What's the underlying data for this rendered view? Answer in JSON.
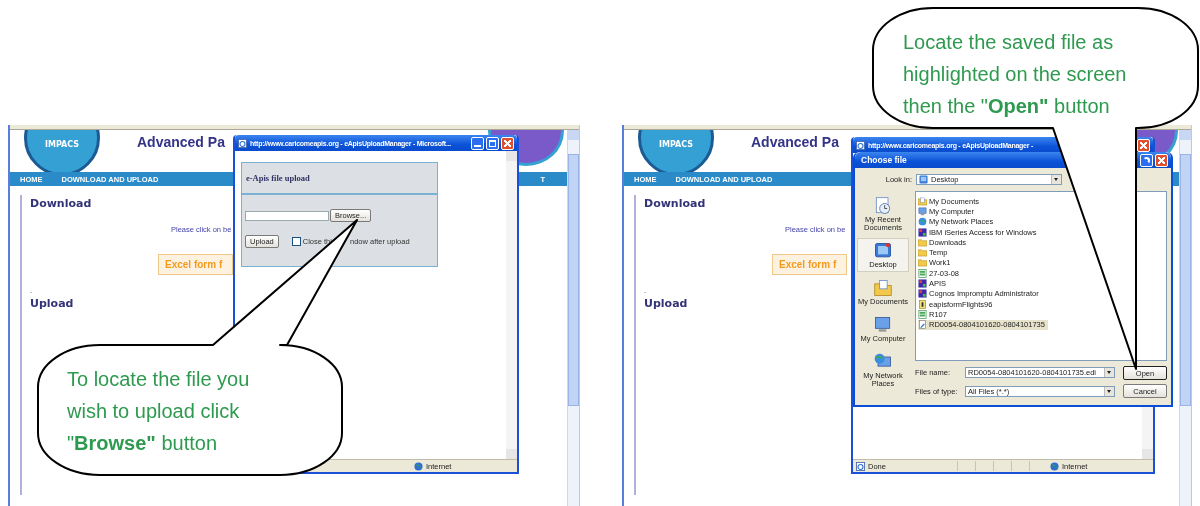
{
  "screenshots": [
    {
      "kind": "upload-popup",
      "page": {
        "logo_text": "IMPACS",
        "title": "Advanced Pa",
        "nav": [
          "HOME",
          "DOWNLOAD AND UPLOAD"
        ],
        "nav_end": "T",
        "download_heading": "Download",
        "download_text": "Please click on be",
        "excel_button": "Excel form f",
        "separator": ".",
        "upload_heading": "Upload"
      },
      "popup": {
        "title": "http://www.caricomeapis.org - eApisUploadManager - Microsoft...",
        "heading": "e-Apis file upload",
        "browse": "Browse...",
        "upload": "Upload",
        "checkbox": {
          "checked": false,
          "label_parts": [
            "Close thi",
            "ndow after upload"
          ]
        },
        "status": [
          {
            "kind": "zone",
            "label": "Internet"
          }
        ]
      },
      "callout": "To locate the file you wish to upload click \"**Browse\"** button"
    },
    {
      "kind": "file-dialog",
      "page": {
        "logo_text": "IMPACS",
        "title": "Advanced Pa",
        "nav": [
          "HOME",
          "DOWNLOAD AND UPLOAD"
        ],
        "download_heading": "Download",
        "download_text": "Please click on be",
        "excel_button": "Excel form f",
        "separator": ".",
        "upload_heading": "Upload"
      },
      "popup": {
        "title": "http://www.caricomeapis.org - eApisUploadManager -",
        "status": [
          {
            "kind": "page",
            "label": "Done"
          },
          {
            "kind": "zone",
            "label": "Internet"
          }
        ]
      },
      "dialog": {
        "title": "Choose file",
        "look_in_label": "Look in:",
        "look_in": "Desktop",
        "places": [
          {
            "kind": "recent",
            "label": "My Recent Documents",
            "selected": false
          },
          {
            "kind": "desktop",
            "label": "Desktop",
            "selected": true
          },
          {
            "kind": "documents",
            "label": "My Documents",
            "selected": false
          },
          {
            "kind": "computer",
            "label": "My Computer",
            "selected": false
          },
          {
            "kind": "network",
            "label": "My Network Places",
            "selected": false
          }
        ],
        "files": [
          {
            "kind": "documents",
            "label": "My Documents",
            "selected": false
          },
          {
            "kind": "computer",
            "label": "My Computer",
            "selected": false
          },
          {
            "kind": "network",
            "label": "My Network Places",
            "selected": false
          },
          {
            "kind": "app",
            "label": "IBM iSeries Access for Windows",
            "selected": false
          },
          {
            "kind": "folder",
            "label": "Downloads",
            "selected": false
          },
          {
            "kind": "folder",
            "label": "Temp",
            "selected": false
          },
          {
            "kind": "folder",
            "label": "Work1",
            "selected": false
          },
          {
            "kind": "spreadsheet",
            "label": "27-03-08",
            "selected": false
          },
          {
            "kind": "app",
            "label": "APIS",
            "selected": false
          },
          {
            "kind": "app",
            "label": "Cognos Impromptu Administrator",
            "selected": false
          },
          {
            "kind": "document",
            "label": "eapisformFlights96",
            "selected": false
          },
          {
            "kind": "spreadsheet",
            "label": "R107",
            "selected": false
          },
          {
            "kind": "file",
            "label": "RD0054-0804101620-0804101735",
            "selected": true
          }
        ],
        "file_name_label": "File name:",
        "file_name": "RD0054-0804101620-0804101735.edi",
        "file_type_label": "Files of type:",
        "file_type": "All Files (*.*)",
        "buttons": [
          "Open",
          "Cancel"
        ]
      },
      "callout": "Locate the saved file as highlighted on the screen then  the \"**Open\"** button"
    }
  ]
}
